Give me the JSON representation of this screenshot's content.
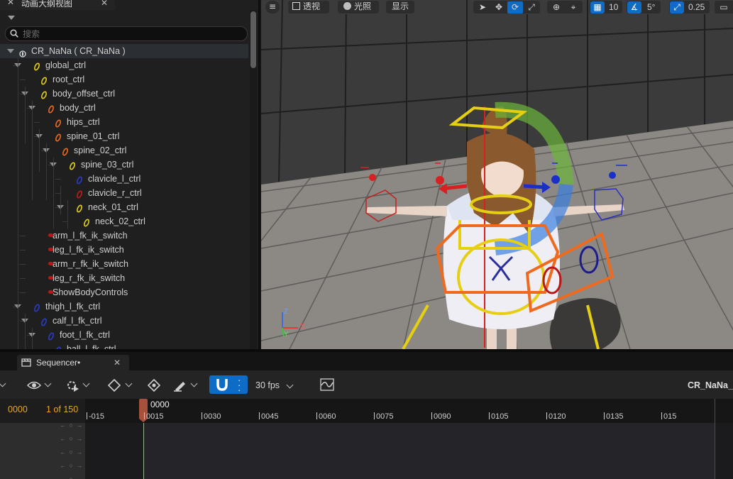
{
  "outliner": {
    "tab_title": "动画大纲视图",
    "search_placeholder": "搜索",
    "items": [
      {
        "label": "CR_NaNa ( CR_NaNa )",
        "depth": 0,
        "icon": "rig-root-icon",
        "expanded": true
      },
      {
        "label": "global_ctrl",
        "depth": 1,
        "icon": "control-yellow-icon",
        "expanded": true
      },
      {
        "label": "root_ctrl",
        "depth": 2,
        "icon": "control-yellow-icon",
        "expanded": false
      },
      {
        "label": "body_offset_ctrl",
        "depth": 2,
        "icon": "control-yellow-icon",
        "expanded": true
      },
      {
        "label": "body_ctrl",
        "depth": 3,
        "icon": "control-orange-icon",
        "expanded": true
      },
      {
        "label": "hips_ctrl",
        "depth": 4,
        "icon": "control-orange-icon",
        "expanded": false
      },
      {
        "label": "spine_01_ctrl",
        "depth": 4,
        "icon": "control-orange-icon",
        "expanded": true
      },
      {
        "label": "spine_02_ctrl",
        "depth": 5,
        "icon": "control-orange-icon",
        "expanded": true
      },
      {
        "label": "spine_03_ctrl",
        "depth": 6,
        "icon": "control-yellow-icon",
        "expanded": true
      },
      {
        "label": "clavicle_l_ctrl",
        "depth": 7,
        "icon": "control-blue-icon",
        "expanded": false
      },
      {
        "label": "clavicle_r_ctrl",
        "depth": 7,
        "icon": "control-red-icon",
        "expanded": false
      },
      {
        "label": "neck_01_ctrl",
        "depth": 7,
        "icon": "control-yellow-icon",
        "expanded": true
      },
      {
        "label": "neck_02_ctrl",
        "depth": 8,
        "icon": "control-yellow-icon",
        "expanded": false
      },
      {
        "label": "arm_l_fk_ik_switch",
        "depth": 2,
        "icon": "switch-red-icon",
        "expanded": false
      },
      {
        "label": "leg_l_fk_ik_switch",
        "depth": 2,
        "icon": "switch-red-icon",
        "expanded": false
      },
      {
        "label": "arm_r_fk_ik_switch",
        "depth": 2,
        "icon": "switch-red-icon",
        "expanded": false
      },
      {
        "label": "leg_r_fk_ik_switch",
        "depth": 2,
        "icon": "switch-red-icon",
        "expanded": false
      },
      {
        "label": "ShowBodyControls",
        "depth": 2,
        "icon": "switch-red-icon",
        "expanded": false
      },
      {
        "label": "thigh_l_fk_ctrl",
        "depth": 1,
        "icon": "control-blue-icon",
        "expanded": true
      },
      {
        "label": "calf_l_fk_ctrl",
        "depth": 2,
        "icon": "control-blue-icon",
        "expanded": true
      },
      {
        "label": "foot_l_fk_ctrl",
        "depth": 3,
        "icon": "control-blue-icon",
        "expanded": true
      },
      {
        "label": "ball_l_fk_ctrl",
        "depth": 4,
        "icon": "control-blue-icon",
        "expanded": false
      }
    ]
  },
  "viewport": {
    "menu_label": "≡",
    "perspective_label": "透视",
    "lighting_label": "光照",
    "show_label": "显示",
    "grid_snap_value": "10",
    "rotation_snap_value": "5°",
    "scale_snap_value": "0.25",
    "axis_labels": {
      "x": "X",
      "y": "Y",
      "z": "Z"
    }
  },
  "sequencer": {
    "tab_title": "Sequencer•",
    "fps_label": "30 fps",
    "sequence_name": "CR_NaNa_T",
    "current_frame": "0000",
    "frame_count": "1 of 150",
    "playhead_label": "0000",
    "ticks": [
      "-015",
      "0015",
      "0030",
      "0045",
      "0060",
      "0075",
      "0090",
      "0105",
      "0120",
      "0135",
      "015"
    ],
    "track_key_glyphs": "← ○ →"
  },
  "colors": {
    "accent": "#0f6cc6",
    "frame_orange": "#e8a52a",
    "playhead": "#a5513b",
    "end_marker": "#b82020"
  }
}
